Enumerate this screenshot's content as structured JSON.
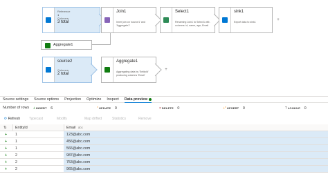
{
  "canvas": {
    "source1": {
      "ref_label": "Reference",
      "ref_count": "1",
      "columns_label": "Columns:",
      "columns_value": "3 total"
    },
    "join1": {
      "title": "Join1",
      "description": "Inner join on 'source1' and 'Aggregate1'"
    },
    "select1": {
      "title": "Select1",
      "description": "Renaming Join1 to Select1 with columns: id, name, age, Email"
    },
    "sink1": {
      "title": "sink1",
      "description": "Export data to sink1"
    },
    "aggregate_ref": {
      "title": "Aggregate1"
    },
    "source2": {
      "title": "source2",
      "columns_label": "Columns:",
      "columns_value": "2 total"
    },
    "aggregate1": {
      "title": "Aggregate1",
      "description": "Aggregating data by 'EntityId' producing columns 'Email'"
    }
  },
  "tabs": [
    {
      "label": "Source settings"
    },
    {
      "label": "Source options"
    },
    {
      "label": "Projection"
    },
    {
      "label": "Optimize"
    },
    {
      "label": "Inspect"
    },
    {
      "label": "Data preview"
    }
  ],
  "stats": {
    "rows_label": "Number of rows",
    "insert_label": "INSERT",
    "insert_value": "6",
    "update_label": "UPDATE",
    "update_value": "0",
    "delete_label": "DELETE",
    "delete_value": "0",
    "upsert_label": "UPSERT",
    "upsert_value": "0",
    "lookup_label": "LOOKUP",
    "lookup_value": "0"
  },
  "toolbar": {
    "refresh": "Refresh",
    "typecast": "Typecast",
    "modify": "Modify",
    "map_drifted": "Map drifted",
    "statistics": "Statistics",
    "remove": "Remove"
  },
  "table": {
    "headers": [
      "EntityId",
      "Email"
    ],
    "header_type": "abc",
    "rows": [
      [
        "1",
        "123@abc.com"
      ],
      [
        "1",
        "456@abc.com"
      ],
      [
        "1",
        "566@abc.com"
      ],
      [
        "2",
        "987@abc.com"
      ],
      [
        "2",
        "753@abc.com"
      ],
      [
        "2",
        "965@abc.com"
      ]
    ]
  },
  "colors": {
    "accent": "#0078d4",
    "source_bg": "#dbeaf7",
    "insert_green": "#107c10"
  }
}
